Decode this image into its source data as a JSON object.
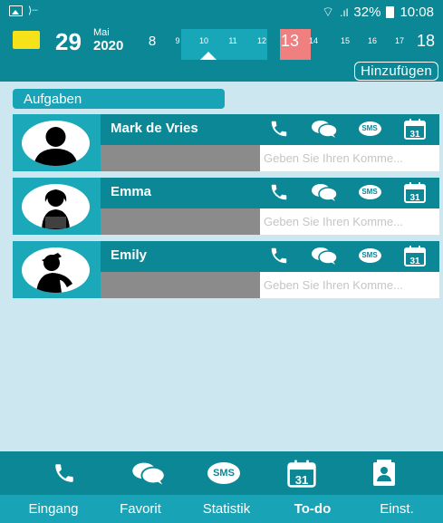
{
  "status_bar": {
    "signal_text": "",
    "battery": "32%",
    "time": "10:08"
  },
  "date_header": {
    "day": "29",
    "month": "Mai",
    "year": "2020",
    "week_days": [
      "8",
      "9",
      "10",
      "11",
      "12",
      "13",
      "14",
      "15",
      "16",
      "17",
      "18"
    ],
    "selected_day": "13",
    "today_color": "#f08080",
    "accent_color": "#f5e218"
  },
  "toolbar": {
    "add_label": "Hinzufügen"
  },
  "section": {
    "title": "Aufgaben"
  },
  "comment_placeholder": "Geben Sie Ihren Komme...",
  "contacts": [
    {
      "name": "Mark de Vries",
      "avatar": "man-silhouette-icon"
    },
    {
      "name": "Emma",
      "avatar": "woman-laptop-icon"
    },
    {
      "name": "Emily",
      "avatar": "person-saluting-icon"
    }
  ],
  "action_icons": [
    "phone-icon",
    "chat-icon",
    "sms-icon",
    "calendar-icon"
  ],
  "sms_text": "SMS",
  "calendar_number": "31",
  "bottom_nav": {
    "icons": [
      "phone-icon",
      "chat-icon",
      "sms-icon",
      "calendar-icon",
      "contact-card-icon"
    ],
    "tabs": [
      "Eingang",
      "Favorit",
      "Statistik",
      "To-do",
      "Einst."
    ],
    "active_tab": "To-do"
  },
  "colors": {
    "primary": "#0b8796",
    "secondary": "#19a3b6",
    "background": "#cde7f1"
  }
}
